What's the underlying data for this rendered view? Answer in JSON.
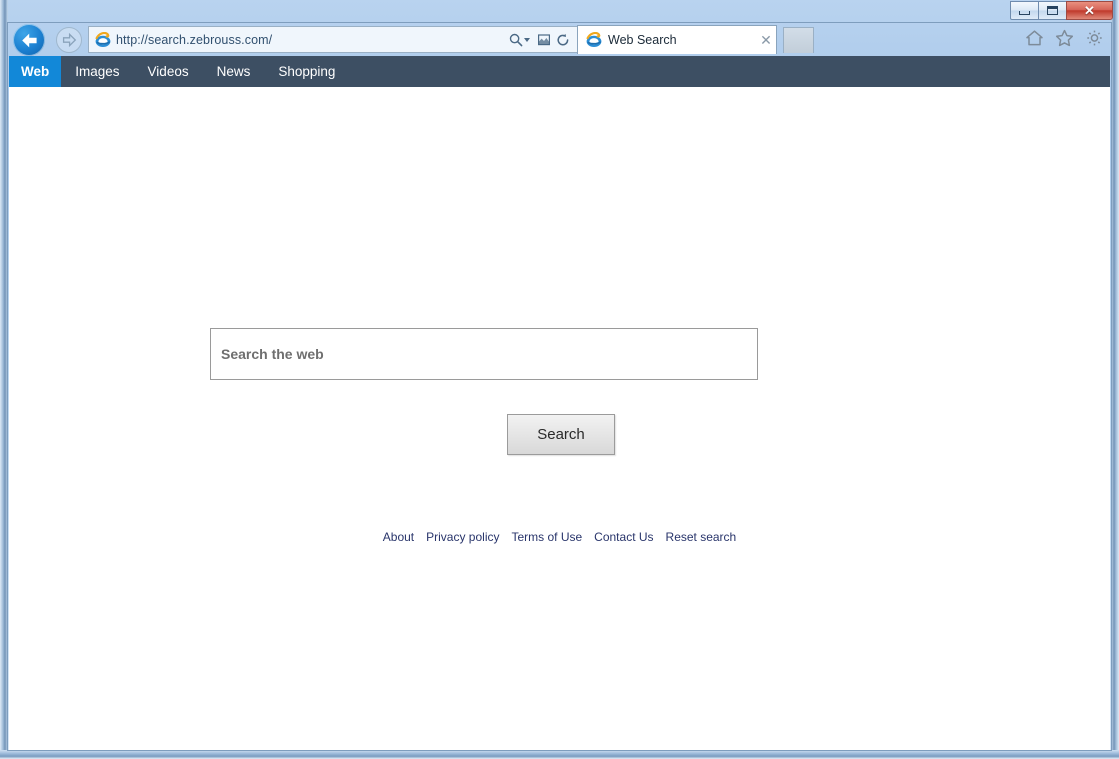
{
  "window": {
    "buttons": {
      "minimize": "minimize-button",
      "maximize": "maximize-button",
      "close_label": "✕"
    }
  },
  "browser": {
    "back_icon": "back-arrow-icon",
    "forward_icon": "forward-arrow-icon",
    "address": {
      "url": "http://search.zebrouss.com/",
      "favicon": "ie-logo-icon",
      "search_icon": "magnifier-icon",
      "compat_icon": "compatibility-view-icon",
      "refresh_icon": "refresh-icon"
    },
    "tab": {
      "title": "Web Search",
      "favicon": "ie-logo-icon",
      "close_label": "✕"
    },
    "new_tab_label": "",
    "commands": {
      "home": "home-icon",
      "favorites": "star-icon",
      "tools": "gear-icon"
    }
  },
  "page": {
    "site_nav": {
      "items": [
        {
          "label": "Web",
          "active": true
        },
        {
          "label": "Images",
          "active": false
        },
        {
          "label": "Videos",
          "active": false
        },
        {
          "label": "News",
          "active": false
        },
        {
          "label": "Shopping",
          "active": false
        }
      ]
    },
    "search": {
      "placeholder": "Search the web",
      "value": "",
      "button_label": "Search"
    },
    "footer": {
      "links": [
        "About",
        "Privacy policy",
        "Terms of Use",
        "Contact Us",
        "Reset search"
      ]
    }
  },
  "colors": {
    "site_nav_bg": "#3d4f63",
    "active_tab_bg": "#1288d8",
    "link": "#29356b",
    "titlebar": "#a9c8ea",
    "close_button": "#c0392c"
  }
}
